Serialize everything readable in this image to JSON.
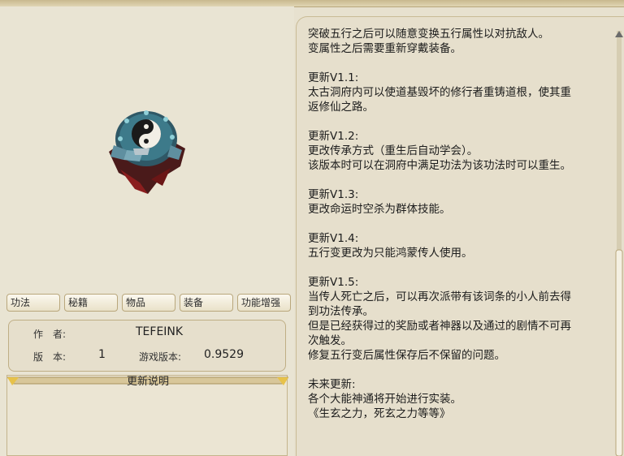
{
  "tabs": [
    {
      "label": "功法"
    },
    {
      "label": "秘籍"
    },
    {
      "label": "物品"
    },
    {
      "label": "装备"
    },
    {
      "label": "功能增强"
    }
  ],
  "info": {
    "author_label": "作　者:",
    "author_value": "TEFEINK",
    "version_label": "版　本:",
    "version_value": "1",
    "game_version_label": "游戏版本:",
    "game_version_value": "0.9529"
  },
  "notes": {
    "title": "更新说明"
  },
  "description": {
    "lines": [
      "突破五行之后可以随意变换五行属性以对抗敌人。",
      "变属性之后需要重新穿戴装备。",
      "",
      "更新V1.1:",
      "太古洞府内可以使道基毁坏的修行者重铸道根，使其重",
      "返修仙之路。",
      "",
      "更新V1.2:",
      "更改传承方式（重生后自动学会）。",
      "该版本时可以在洞府中满足功法为该功法时可以重生。",
      "",
      "更新V1.3:",
      "更改命运时空杀为群体技能。",
      "",
      "更新V1.4:",
      "五行变更改为只能鸿蒙传人使用。",
      "",
      "更新V1.5:",
      "当传人死亡之后，可以再次派带有该词条的小人前去得",
      "到功法传承。",
      "但是已经获得过的奖励或者神器以及通过的剧情不可再",
      "次触发。",
      "修复五行变后属性保存后不保留的问题。",
      "",
      "未来更新:",
      "各个大能神通将开始进行实装。",
      "《生玄之力，死玄之力等等》"
    ]
  },
  "icons": {
    "artifact": "yin-yang-artifact-icon"
  }
}
